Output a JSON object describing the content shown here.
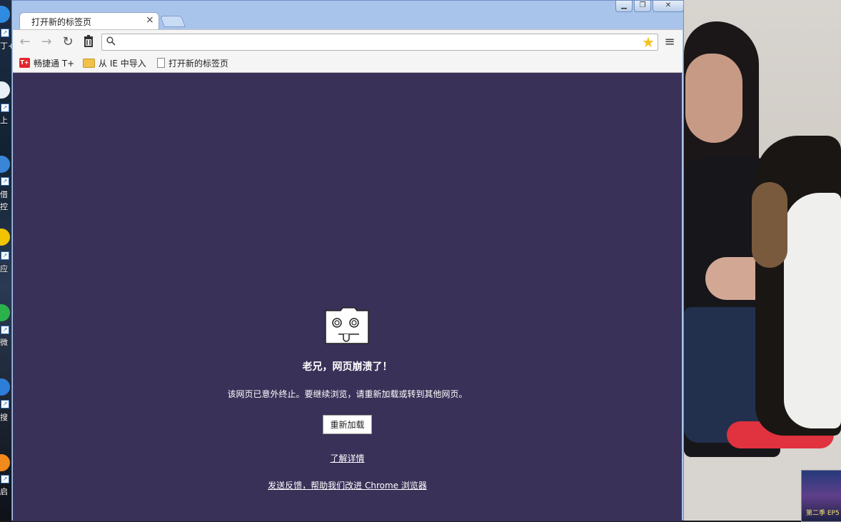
{
  "window": {
    "tab_title": "打开新的标签页",
    "tab_close_glyph": "×"
  },
  "toolbar": {
    "back_glyph": "←",
    "forward_glyph": "→",
    "reload_glyph": "↻",
    "trash_glyph": "🗑",
    "address_value": "",
    "star_glyph": "★",
    "menu_glyph": "≡"
  },
  "bookmarks": [
    {
      "label": "畅捷通 T+",
      "icon": "tplus-logo-icon"
    },
    {
      "label": "从 IE 中导入",
      "icon": "folder-icon"
    },
    {
      "label": "打开新的标签页",
      "icon": "page-icon"
    }
  ],
  "bookmark_icon_text": "T+",
  "crash": {
    "title": "老兄，网页崩溃了！",
    "message": "该网页已意外终止。要继续浏览，请重新加载或转到其他网页。",
    "reload_label": "重新加载",
    "learn_more": "了解详情",
    "feedback": "发送反馈，帮助我们改进 Chrome 浏览器"
  },
  "desktop": {
    "left_labels": [
      "丁+",
      "上",
      "借",
      "控",
      "应",
      "微",
      "搜",
      "启"
    ],
    "thumbnail_text": "第二季 EP5"
  },
  "colors": {
    "crash_background": "#3a3158",
    "chrome_frame": "#a9c4ea",
    "toolbar": "#f5f5f5"
  }
}
